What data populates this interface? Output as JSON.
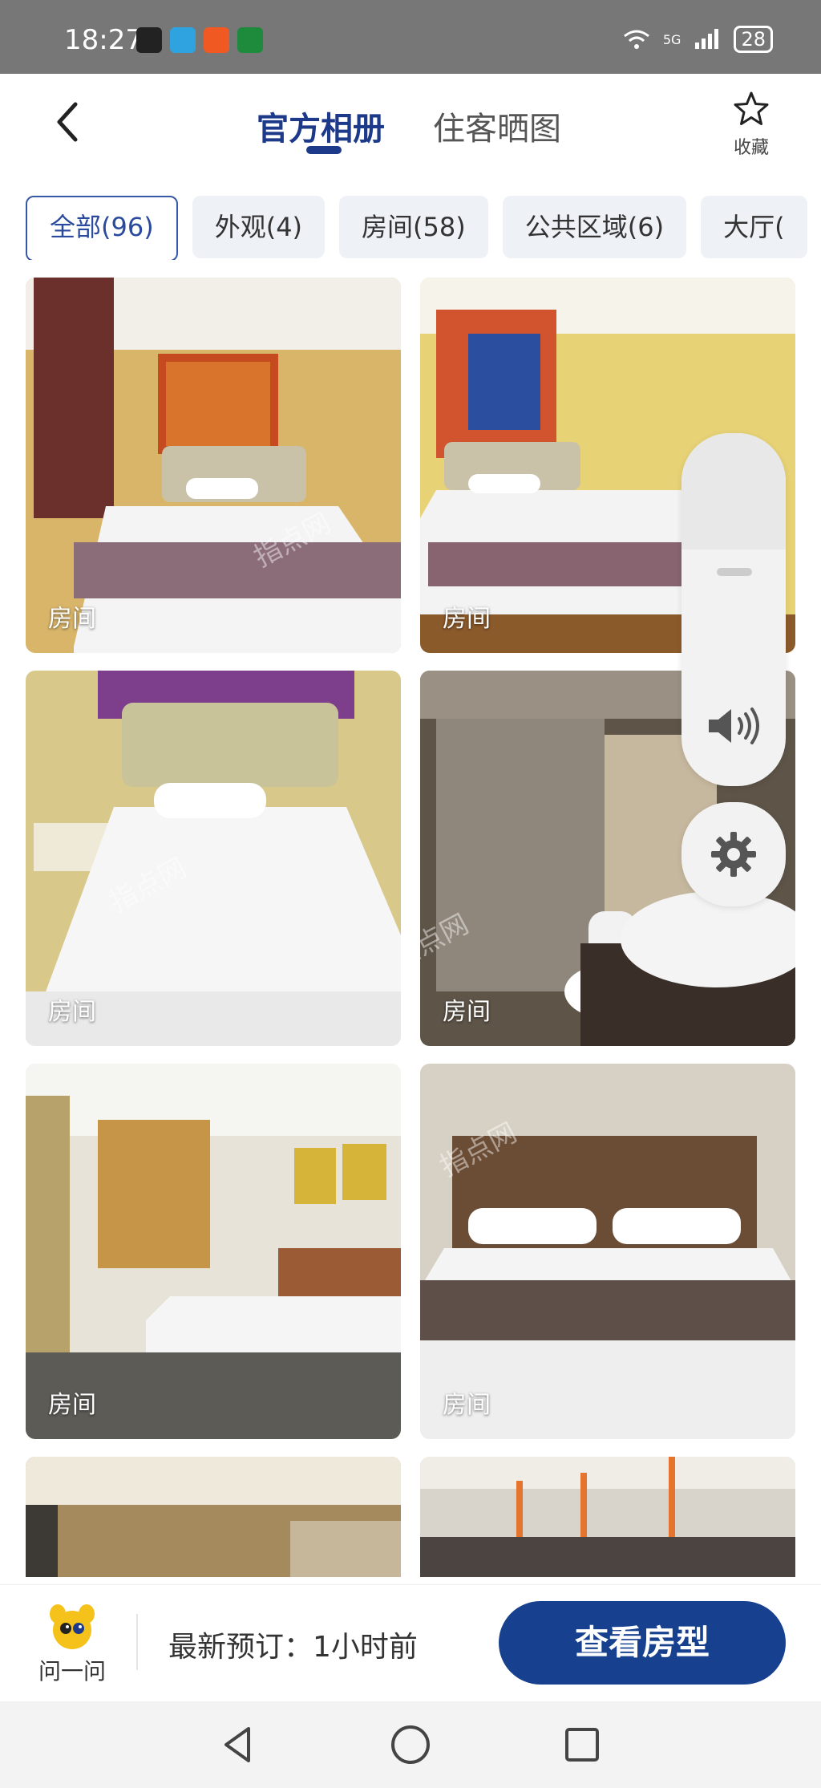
{
  "status_bar": {
    "time": "18:27",
    "network": "5G",
    "battery": "28"
  },
  "header": {
    "tabs": [
      {
        "label": "官方相册",
        "active": true
      },
      {
        "label": "住客晒图",
        "active": false
      }
    ],
    "favorite_label": "收藏"
  },
  "filters": [
    {
      "label": "全部(96)",
      "active": true
    },
    {
      "label": "外观(4)",
      "active": false
    },
    {
      "label": "房间(58)",
      "active": false
    },
    {
      "label": "公共区域(6)",
      "active": false
    },
    {
      "label": "大厅(",
      "active": false
    }
  ],
  "photos": [
    {
      "label": "房间"
    },
    {
      "label": "房间"
    },
    {
      "label": "房间"
    },
    {
      "label": "房间"
    },
    {
      "label": "房间"
    },
    {
      "label": "房间"
    },
    {
      "label": ""
    },
    {
      "label": ""
    }
  ],
  "watermark": "指点网",
  "bottom_bar": {
    "ask_label": "问一问",
    "latest_booking": "最新预订：1小时前",
    "view_rooms_button": "查看房型"
  },
  "colors": {
    "accent": "#17408f",
    "chip_bg": "#eef1f6"
  }
}
